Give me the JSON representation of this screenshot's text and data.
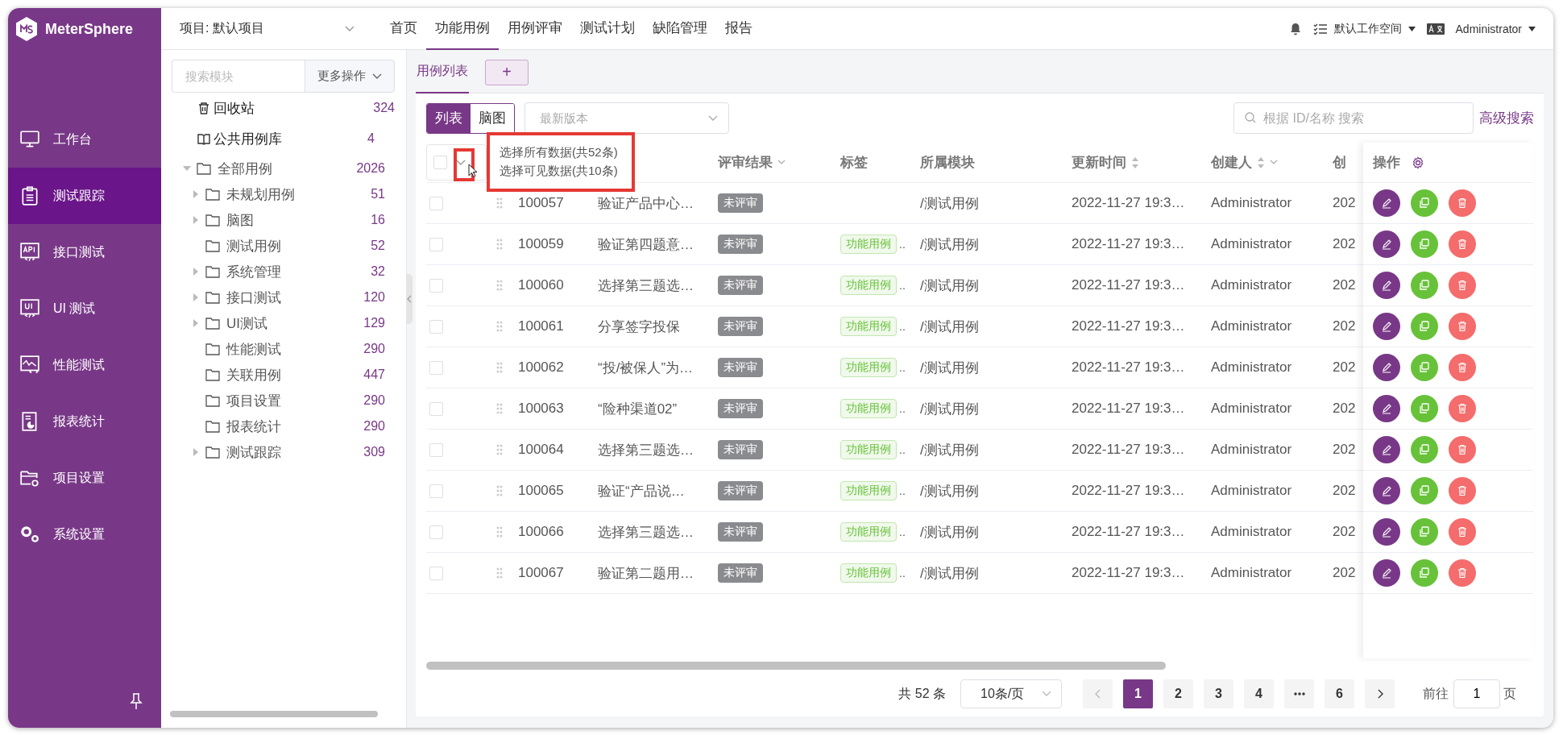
{
  "app": {
    "logo": "MeterSphere"
  },
  "sidebar": {
    "items": [
      {
        "label": "工作台",
        "selected": false
      },
      {
        "label": "测试跟踪",
        "selected": true
      },
      {
        "label": "接口测试",
        "selected": false
      },
      {
        "label": "UI 测试",
        "selected": false
      },
      {
        "label": "性能测试",
        "selected": false
      },
      {
        "label": "报表统计",
        "selected": false
      },
      {
        "label": "项目设置",
        "selected": false
      },
      {
        "label": "系统设置",
        "selected": false
      }
    ]
  },
  "header": {
    "project": "项目: 默认项目",
    "nav": [
      {
        "label": "首页",
        "selected": false
      },
      {
        "label": "功能用例",
        "selected": true
      },
      {
        "label": "用例评审",
        "selected": false
      },
      {
        "label": "测试计划",
        "selected": false
      },
      {
        "label": "缺陷管理",
        "selected": false
      },
      {
        "label": "报告",
        "selected": false
      }
    ],
    "workspace": "默认工作空间",
    "user": "Administrator"
  },
  "module_tree": {
    "search": {
      "placeholder": "搜索模块"
    },
    "more_button": "更多操作",
    "special_items": [
      {
        "kind": "trash",
        "label": "回收站",
        "count": "324"
      },
      {
        "kind": "library",
        "label": "公共用例库",
        "count": "4"
      }
    ],
    "tree": [
      {
        "kind": "branch",
        "label": "全部用例",
        "count": "2026",
        "expanded": true,
        "children": [
          {
            "kind": "branch",
            "label": "未规划用例",
            "count": "51",
            "expanded": false
          },
          {
            "kind": "branch",
            "label": "脑图",
            "count": "16",
            "expanded": false
          },
          {
            "kind": "leaf",
            "label": "测试用例",
            "count": "52"
          },
          {
            "kind": "branch",
            "label": "系统管理",
            "count": "32",
            "expanded": false
          },
          {
            "kind": "branch",
            "label": "接口测试",
            "count": "120",
            "expanded": false
          },
          {
            "kind": "branch",
            "label": "UI测试",
            "count": "129",
            "expanded": false
          },
          {
            "kind": "leaf",
            "label": "性能测试",
            "count": "290"
          },
          {
            "kind": "leaf",
            "label": "关联用例",
            "count": "447"
          },
          {
            "kind": "leaf",
            "label": "项目设置",
            "count": "290"
          },
          {
            "kind": "leaf",
            "label": "报表统计",
            "count": "290"
          },
          {
            "kind": "branch",
            "label": "测试跟踪",
            "count": "309",
            "expanded": false
          }
        ]
      }
    ]
  },
  "tabs": [
    {
      "label": "用例列表",
      "selected": true
    }
  ],
  "add_tab_button": "+",
  "view_toggle": [
    {
      "label": "列表",
      "selected": true
    },
    {
      "label": "脑图",
      "selected": false
    }
  ],
  "version_select": {
    "placeholder": "最新版本"
  },
  "search": {
    "placeholder": "根据 ID/名称 搜索"
  },
  "advanced_search": "高级搜索",
  "selection_menu": {
    "items": [
      "选择所有数据(共52条)",
      "选择可见数据(共10条)"
    ]
  },
  "table": {
    "select_all": {
      "checked": false
    },
    "columns": [
      {
        "label": "评审结果",
        "sortable": false,
        "filterable": true
      },
      {
        "label": "标签",
        "sortable": false,
        "filterable": false
      },
      {
        "label": "所属模块",
        "sortable": false,
        "filterable": false
      },
      {
        "label": "更新时间",
        "sortable": true,
        "filterable": false
      },
      {
        "label": "创建人",
        "sortable": true,
        "filterable": true
      },
      {
        "label": "创",
        "sortable": false,
        "filterable": false
      }
    ],
    "actions_column": {
      "label": "操作"
    },
    "rows": [
      {
        "checked": false,
        "id": "100057",
        "name": "验证产品中心…",
        "review": "未评审",
        "module": "/测试用例",
        "updated": "2022-11-27 19:3…",
        "creator": "Administrator",
        "created": "202"
      },
      {
        "checked": false,
        "id": "100059",
        "name": "验证第四题意…",
        "review": "未评审",
        "tag": "功能用例",
        "tag_more": "..",
        "module": "/测试用例",
        "updated": "2022-11-27 19:3…",
        "creator": "Administrator",
        "created": "202"
      },
      {
        "checked": false,
        "id": "100060",
        "name": "选择第三题选…",
        "review": "未评审",
        "tag": "功能用例",
        "tag_more": "..",
        "module": "/测试用例",
        "updated": "2022-11-27 19:3…",
        "creator": "Administrator",
        "created": "202"
      },
      {
        "checked": false,
        "id": "100061",
        "name": "分享签字投保",
        "review": "未评审",
        "tag": "功能用例",
        "tag_more": "..",
        "module": "/测试用例",
        "updated": "2022-11-27 19:3…",
        "creator": "Administrator",
        "created": "202"
      },
      {
        "checked": false,
        "id": "100062",
        "name": "“投/被保人”为…",
        "review": "未评审",
        "tag": "功能用例",
        "tag_more": "..",
        "module": "/测试用例",
        "updated": "2022-11-27 19:3…",
        "creator": "Administrator",
        "created": "202"
      },
      {
        "checked": false,
        "id": "100063",
        "name": "“险种渠道02”",
        "review": "未评审",
        "tag": "功能用例",
        "tag_more": "..",
        "module": "/测试用例",
        "updated": "2022-11-27 19:3…",
        "creator": "Administrator",
        "created": "202"
      },
      {
        "checked": false,
        "id": "100064",
        "name": "选择第三题选…",
        "review": "未评审",
        "tag": "功能用例",
        "tag_more": "..",
        "module": "/测试用例",
        "updated": "2022-11-27 19:3…",
        "creator": "Administrator",
        "created": "202"
      },
      {
        "checked": false,
        "id": "100065",
        "name": "验证“产品说…",
        "review": "未评审",
        "tag": "功能用例",
        "tag_more": "..",
        "module": "/测试用例",
        "updated": "2022-11-27 19:3…",
        "creator": "Administrator",
        "created": "202"
      },
      {
        "checked": false,
        "id": "100066",
        "name": "选择第三题选…",
        "review": "未评审",
        "tag": "功能用例",
        "tag_more": "..",
        "module": "/测试用例",
        "updated": "2022-11-27 19:3…",
        "creator": "Administrator",
        "created": "202"
      },
      {
        "checked": false,
        "id": "100067",
        "name": "验证第二题用…",
        "review": "未评审",
        "tag": "功能用例",
        "tag_more": "..",
        "module": "/测试用例",
        "updated": "2022-11-27 19:3…",
        "creator": "Administrator",
        "created": "202"
      }
    ]
  },
  "pagination": {
    "total": "共 52 条",
    "page_size": "10条/页",
    "pages": [
      {
        "kind": "page",
        "label": "1",
        "selected": true
      },
      {
        "kind": "page",
        "label": "2",
        "selected": false
      },
      {
        "kind": "page",
        "label": "3",
        "selected": false
      },
      {
        "kind": "page",
        "label": "4",
        "selected": false
      },
      {
        "kind": "more",
        "selected": false
      },
      {
        "kind": "page",
        "label": "6",
        "selected": false
      }
    ],
    "goto": {
      "label": "前往",
      "value": "1",
      "suffix": "页"
    }
  }
}
